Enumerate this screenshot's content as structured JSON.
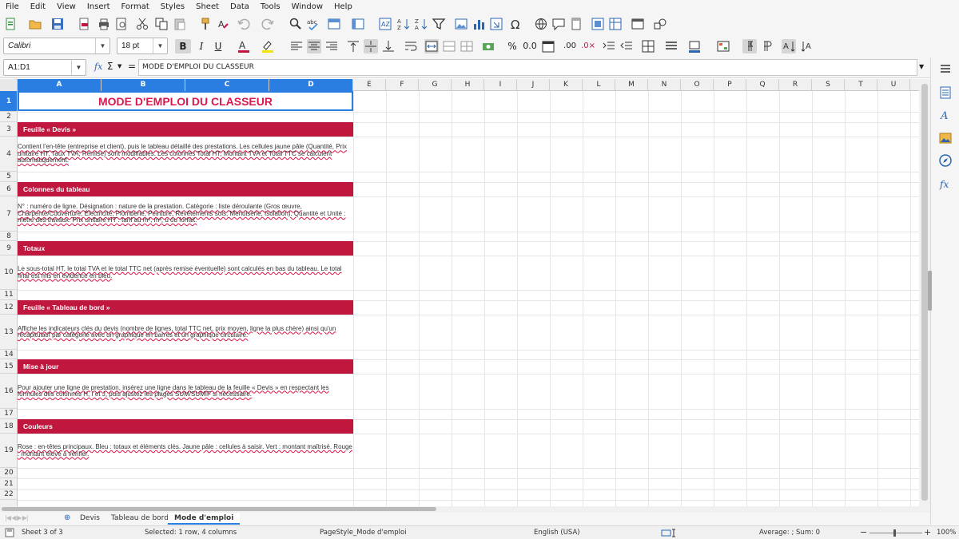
{
  "menu": [
    "File",
    "Edit",
    "View",
    "Insert",
    "Format",
    "Styles",
    "Sheet",
    "Data",
    "Tools",
    "Window",
    "Help"
  ],
  "format": {
    "font_name": "Calibri",
    "font_size": "18 pt",
    "bold_label": "B",
    "italic_label": "I",
    "underline_label": "U"
  },
  "formula": {
    "name_box": "A1:D1",
    "content": "MODE D'EMPLOI DU CLASSEUR",
    "fx_label": "fx",
    "sigma_label": "Σ",
    "equals_label": "="
  },
  "columns": [
    "A",
    "B",
    "C",
    "D",
    "E",
    "F",
    "G",
    "H",
    "I",
    "J",
    "K",
    "L",
    "M",
    "N",
    "O",
    "P",
    "Q",
    "R",
    "S",
    "T",
    "U"
  ],
  "rows": [
    "1",
    "2",
    "3",
    "4",
    "5",
    "6",
    "7",
    "8",
    "9",
    "10",
    "11",
    "12",
    "13",
    "14",
    "15",
    "16",
    "17",
    "18",
    "19",
    "20",
    "21",
    "22"
  ],
  "sheet": {
    "title": "MODE D'EMPLOI DU CLASSEUR",
    "sections": [
      {
        "heading": "Feuille « Devis »",
        "text": "Contient l'en-tête (entreprise et client), puis le tableau détaillé des prestations. Les cellules jaune pâle (Quantité, Prix unitaire HT, Taux TVA, Remise) sont modifiables. Les colonnes Total HT, Montant TVA et Total TTC se calculent automatiquement."
      },
      {
        "heading": "Colonnes du tableau",
        "text": "N° : numéro de ligne. Désignation : nature de la prestation. Catégorie : liste déroulante (Gros œuvre, Charpente/Couverture, Électricité, Plomberie, Peinture, Revêtements sols, Menuiserie, Isolation). Quantité et Unité : métré des travaux. Prix unitaire HT : tarif au m², m³, u ou forfait."
      },
      {
        "heading": "Totaux",
        "text": "Le sous-total HT, le total TVA et le total TTC net (après remise éventuelle) sont calculés en bas du tableau. Le total final est mis en évidence en bleu."
      },
      {
        "heading": "Feuille « Tableau de bord »",
        "text": "Affiche les indicateurs clés du devis (nombre de lignes, total TTC net, prix moyen, ligne la plus chère) ainsi qu'un récapitulatif par catégorie avec un graphique en barres et un graphique circulaire."
      },
      {
        "heading": "Mise à jour",
        "text": "Pour ajouter une ligne de prestation, insérez une ligne dans le tableau de la feuille « Devis » en respectant les formules des colonnes H, I et J, puis ajustez les plages SUM/SUMIF si nécessaire."
      },
      {
        "heading": "Couleurs",
        "text": "Rose : en-têtes principaux. Bleu : totaux et éléments clés. Jaune pâle : cellules à saisir. Vert : montant maîtrisé. Rouge : montant élevé à vérifier."
      }
    ]
  },
  "tabs": [
    "Devis",
    "Tableau de bord",
    "Mode d'emploi"
  ],
  "active_tab": "Mode d'emploi",
  "status": {
    "sheet": "Sheet 3 of 3",
    "selection": "Selected: 1 row, 4 columns",
    "page_style": "PageStyle_Mode d'emploi",
    "language": "English (USA)",
    "summary": "Average: ; Sum: 0",
    "zoom": "100%"
  },
  "colors": {
    "accent": "#2a7de1",
    "band": "#c0173f",
    "title": "#d8194e"
  }
}
